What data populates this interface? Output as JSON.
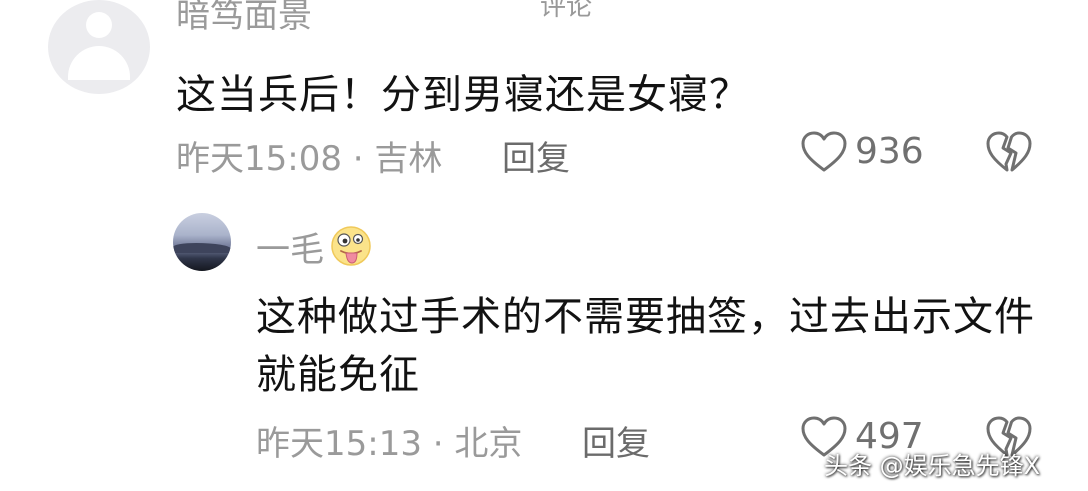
{
  "top_partial_text": "评论",
  "comments": [
    {
      "username": "暗笃面景",
      "content": "这当兵后！分到男寝还是女寝？",
      "time": "昨天15:08",
      "location": "吉林",
      "reply_label": "回复",
      "like_count": "936",
      "like_icon": "heart-outline-icon",
      "dislike_icon": "broken-heart-icon"
    }
  ],
  "replies": [
    {
      "username": "一毛",
      "emoji": "tongue-out-emoji",
      "content": "这种做过手术的不需要抽签，过去出示文件就能免征",
      "time": "昨天15:13",
      "location": "北京",
      "reply_label": "回复",
      "like_count": "497",
      "like_icon": "heart-outline-icon",
      "dislike_icon": "broken-heart-icon"
    }
  ],
  "meta_separator": "·",
  "watermark": "头条 @娱乐急先锋X",
  "colors": {
    "primary_text": "#121212",
    "secondary_text": "#9a9a9a",
    "action_text": "#6b6b6b",
    "icon_stroke": "#707070"
  }
}
